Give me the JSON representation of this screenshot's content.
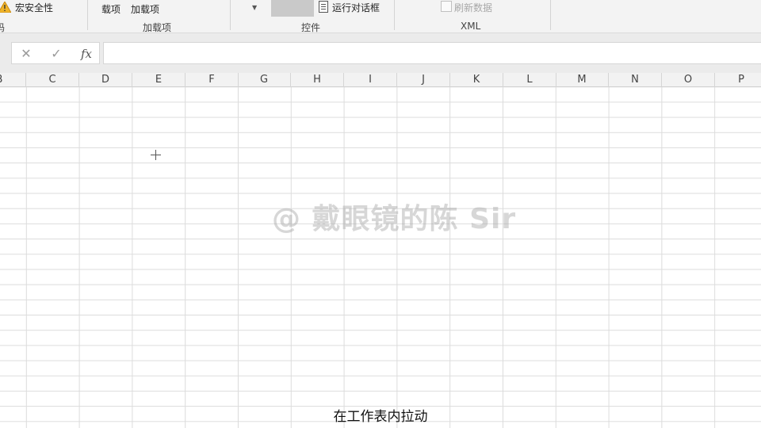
{
  "ribbon": {
    "macro_security": "宏安全性",
    "partial_left_label": "码",
    "addins_left": "载项",
    "addins": "加载项",
    "addins_group_label": "加载项",
    "run_dialog": "运行对话框",
    "controls_group_label": "控件",
    "refresh_data": "刷新数据",
    "xml_group_label": "XML"
  },
  "formula_bar": {
    "cancel_symbol": "✕",
    "enter_symbol": "✓",
    "fx_symbol": "fx",
    "formula_value": ""
  },
  "columns": [
    "B",
    "C",
    "D",
    "E",
    "F",
    "G",
    "H",
    "I",
    "J",
    "K",
    "L",
    "M",
    "N",
    "O",
    "P"
  ],
  "watermark": "@ 戴眼镜的陈 Sir",
  "subtitle": "在工作表内拉动",
  "colors": {
    "ribbon_bg": "#f3f3f3",
    "grid_line": "#dcdcdc",
    "header_bg": "#f2f2f2",
    "warning": "#f0b429"
  },
  "icons": [
    "warning-icon",
    "dropdown-arrow-icon",
    "dialog-icon",
    "refresh-icon",
    "cancel-icon",
    "enter-icon",
    "fx-icon",
    "crosshair-cursor-icon"
  ]
}
